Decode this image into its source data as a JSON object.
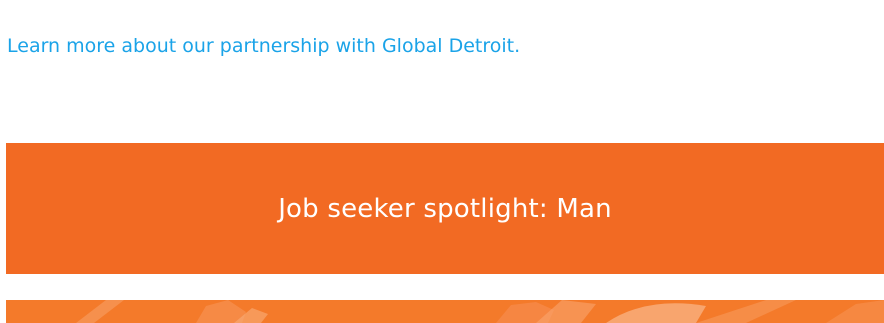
{
  "content": {
    "partnership_link": "Learn more about our partnership with Global Detroit."
  },
  "spotlight": {
    "title": "Job seeker spotlight: Man"
  },
  "colors": {
    "link": "#1aa3e8",
    "banner": "#f26a23",
    "hero": "#f47a2a"
  }
}
